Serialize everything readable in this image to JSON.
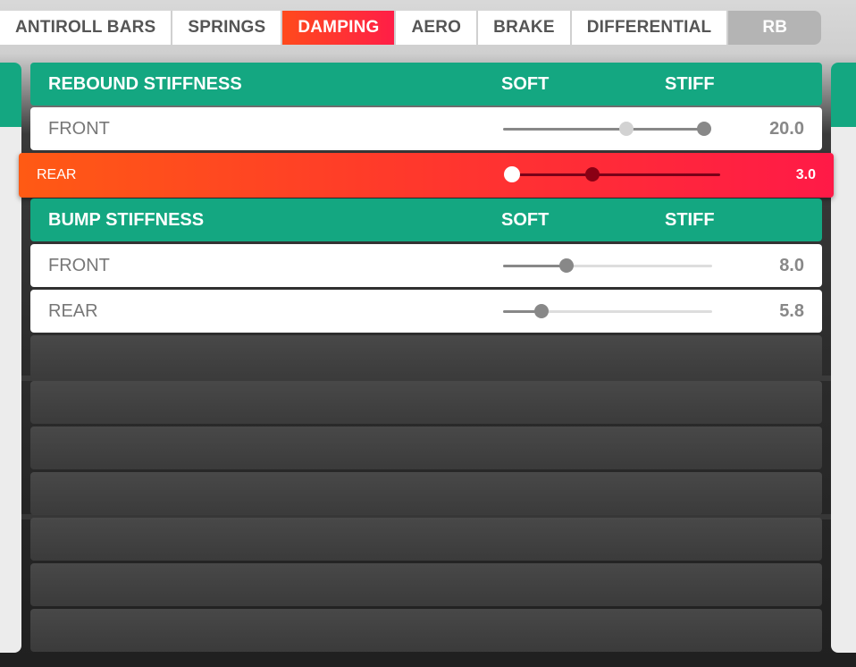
{
  "tabs": [
    {
      "label": "ANTIROLL BARS"
    },
    {
      "label": "SPRINGS"
    },
    {
      "label": "DAMPING"
    },
    {
      "label": "AERO"
    },
    {
      "label": "BRAKE"
    },
    {
      "label": "DIFFERENTIAL"
    },
    {
      "label": "RB"
    }
  ],
  "active_tab": "DAMPING",
  "rebound": {
    "title": "REBOUND STIFFNESS",
    "soft_label": "SOFT",
    "stiff_label": "STIFF",
    "front": {
      "label": "FRONT",
      "value": "20.0",
      "slider_level": 1.0,
      "default_level": 0.59
    },
    "rear": {
      "label": "REAR",
      "value": "3.0",
      "slider_level": 0.0,
      "default_level": 0.37
    }
  },
  "bump": {
    "title": "BUMP STIFFNESS",
    "soft_label": "SOFT",
    "stiff_label": "STIFF",
    "front": {
      "label": "FRONT",
      "value": "8.0",
      "slider_level": 0.31
    },
    "rear": {
      "label": "REAR",
      "value": "5.8",
      "slider_level": 0.18
    }
  },
  "colors": {
    "header": "#14a781",
    "selected_start": "#ff5a14",
    "selected_end": "#ff1a47",
    "row": "#ffffff"
  }
}
